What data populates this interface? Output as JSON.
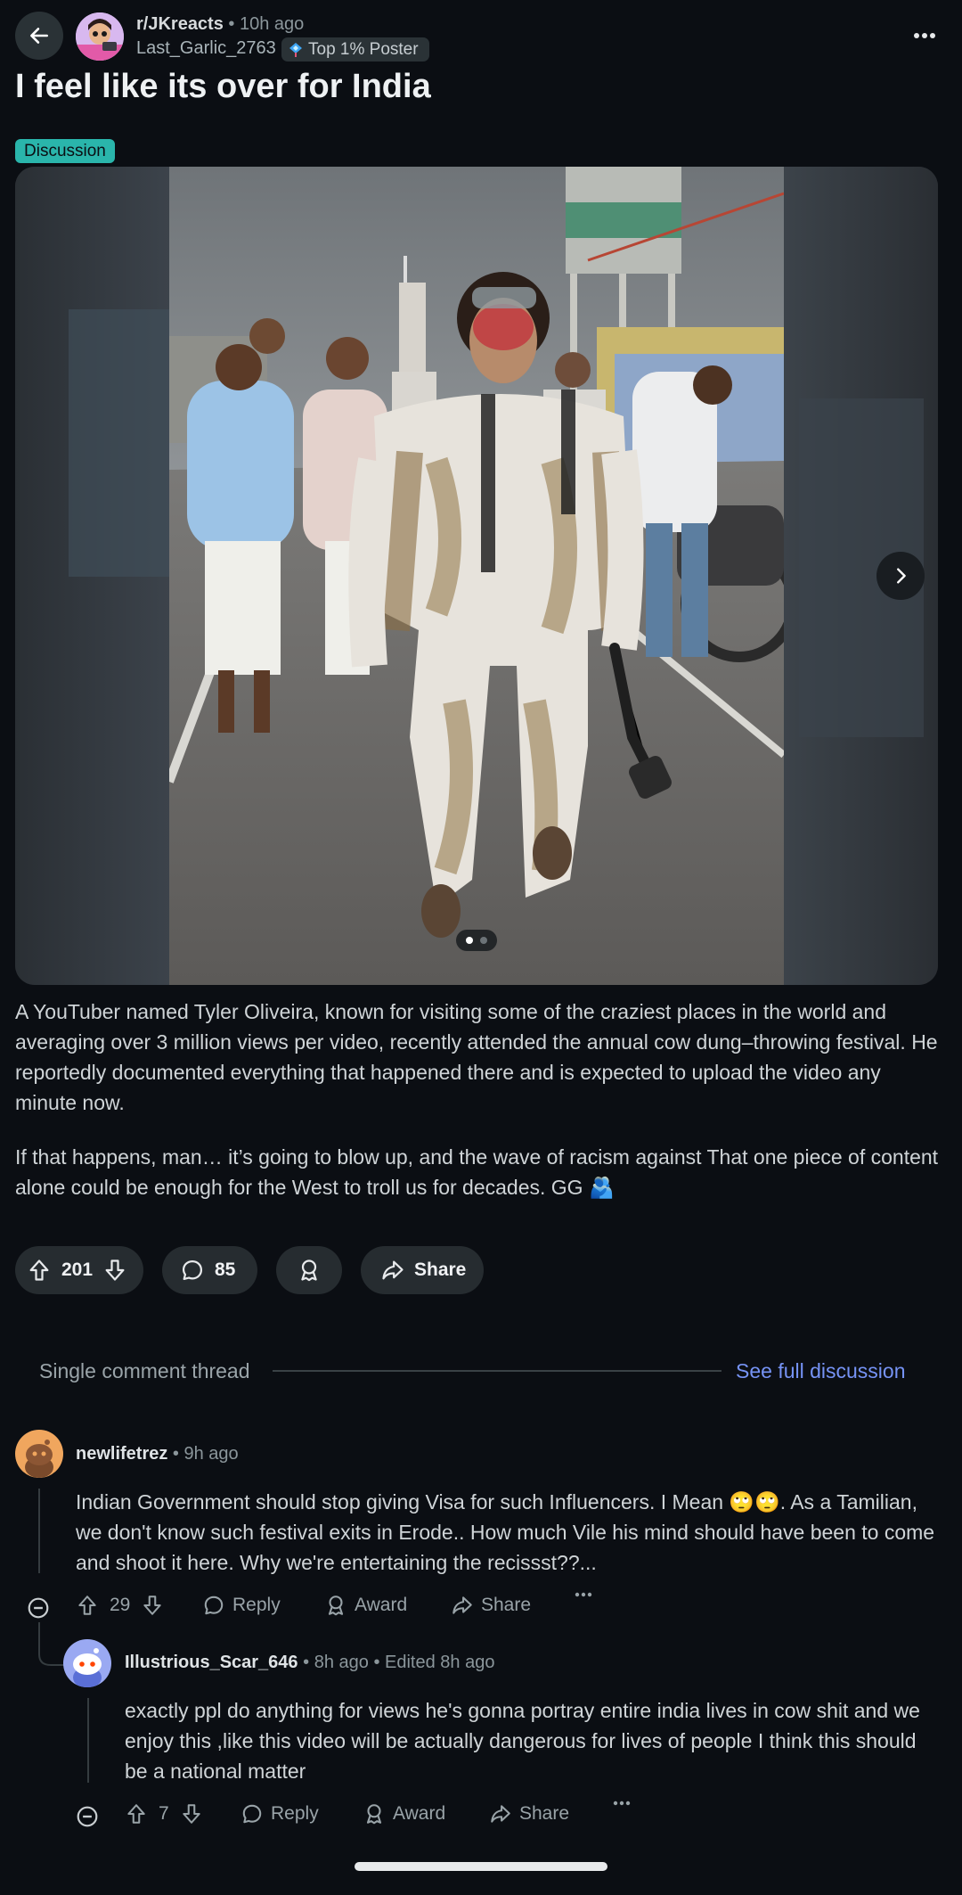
{
  "header": {
    "subreddit": "r/JKreacts",
    "separator": "•",
    "time_ago": "10h ago",
    "author": "Last_Garlic_2763",
    "flair": "Top 1% Poster"
  },
  "post": {
    "title": "I feel like its over for India",
    "tag": "Discussion",
    "body_paragraph_1": "A YouTuber named Tyler Oliveira, known for visiting some of the craziest places in the world and averaging over 3 million views per video, recently attended the annual cow dung–throwing festival. He reportedly documented everything that happened there and is expected to upload the video any minute now.",
    "body_paragraph_2": "If that happens, man… it’s going to blow up, and the wave of racism against That one piece of content alone could be enough for the West to troll us for decades. GG 🫂",
    "media_pages": 2,
    "media_current_page": 1
  },
  "actions": {
    "upvotes": "201",
    "comments": "85",
    "share_label": "Share"
  },
  "thread": {
    "label": "Single comment thread",
    "link": "See full discussion"
  },
  "comments": [
    {
      "user": "newlifetrez",
      "sep": "•",
      "time": "9h ago",
      "text": "Indian Government should stop giving Visa for such Influencers. I Mean 🙄🙄. As a Tamilian, we don't know such festival exits in Erode.. How much Vile his mind should have been to come and shoot it here. Why we're entertaining the recissst??...",
      "votes": "29",
      "reply_label": "Reply",
      "award_label": "Award",
      "share_label": "Share"
    },
    {
      "user": "Illustrious_Scar_646",
      "sep": "•",
      "time": "8h ago",
      "edited": "Edited 8h ago",
      "text": "exactly ppl do anything for views he's gonna portray entire india lives in cow shit and we enjoy this ,like this video will be actually dangerous for lives of people I think this should be a national matter",
      "votes": "7",
      "reply_label": "Reply",
      "award_label": "Award",
      "share_label": "Share"
    }
  ],
  "colors": {
    "background": "#0b0e13",
    "tag": "#2ab5ab",
    "link": "#7693f5",
    "pill": "#262c30"
  },
  "icons": [
    "back-arrow-icon",
    "more-icon",
    "chevron-right-icon",
    "upvote-icon",
    "downvote-icon",
    "comment-icon",
    "award-icon",
    "share-icon",
    "collapse-icon"
  ]
}
